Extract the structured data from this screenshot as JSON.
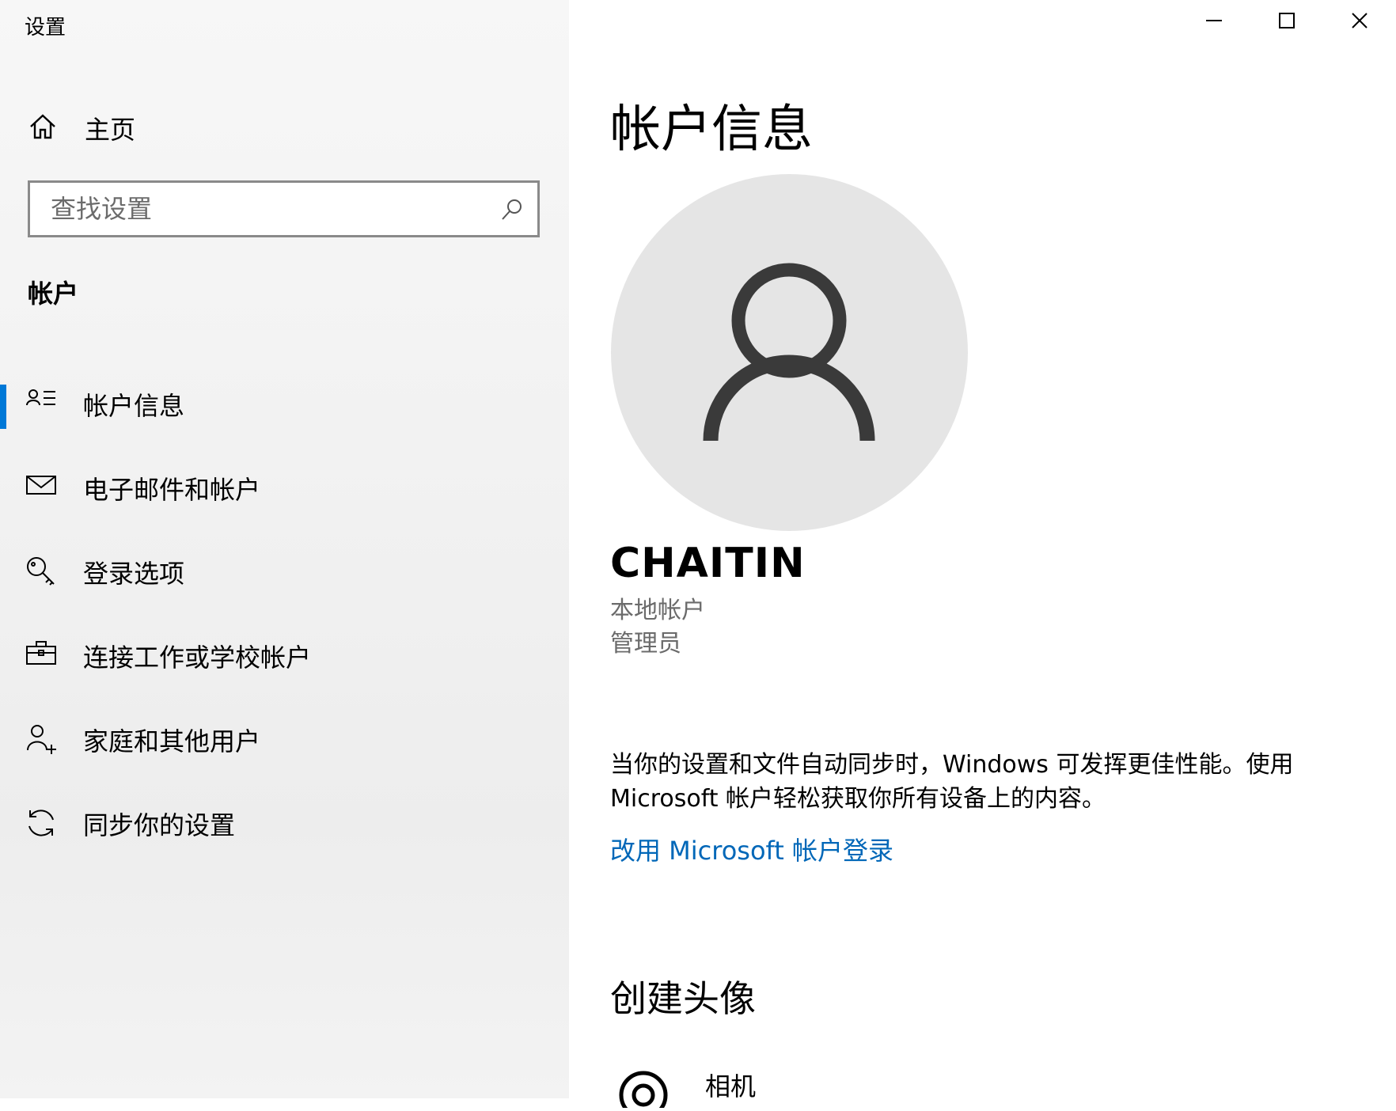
{
  "window": {
    "title": "设置"
  },
  "sidebar": {
    "home_label": "主页",
    "search_placeholder": "查找设置",
    "section_label": "帐户",
    "items": [
      {
        "label": "帐户信息",
        "icon": "account-info-icon",
        "active": true
      },
      {
        "label": "电子邮件和帐户",
        "icon": "mail-icon",
        "active": false
      },
      {
        "label": "登录选项",
        "icon": "key-icon",
        "active": false
      },
      {
        "label": "连接工作或学校帐户",
        "icon": "briefcase-icon",
        "active": false
      },
      {
        "label": "家庭和其他用户",
        "icon": "add-person-icon",
        "active": false
      },
      {
        "label": "同步你的设置",
        "icon": "sync-icon",
        "active": false
      }
    ]
  },
  "main": {
    "title": "帐户信息",
    "username": "CHAITIN",
    "account_type": "本地帐户",
    "role": "管理员",
    "description": "当你的设置和文件自动同步时，Windows 可发挥更佳性能。使用 Microsoft 帐户轻松获取你所有设备上的内容。",
    "link_label": "改用 Microsoft 帐户登录",
    "create_avatar_heading": "创建头像",
    "camera_label": "相机"
  },
  "colors": {
    "accent": "#0078d7",
    "link": "#0067b8",
    "avatar_bg": "#e5e5e5"
  }
}
